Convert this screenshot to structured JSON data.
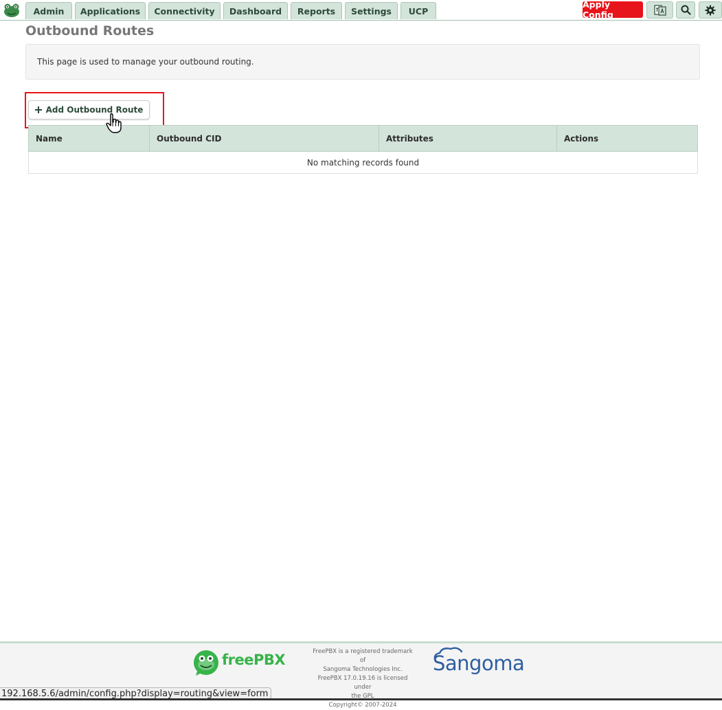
{
  "nav": {
    "tabs": [
      {
        "label": "Admin"
      },
      {
        "label": "Applications"
      },
      {
        "label": "Connectivity"
      },
      {
        "label": "Dashboard"
      },
      {
        "label": "Reports"
      },
      {
        "label": "Settings"
      },
      {
        "label": "UCP"
      }
    ],
    "apply_label": "Apply Config",
    "icons": [
      "language-icon",
      "search-icon",
      "gear-icon"
    ]
  },
  "page": {
    "title": "Outbound Routes",
    "info": "This page is used to manage your outbound routing.",
    "add_button": "Add Outbound Route"
  },
  "table": {
    "columns": [
      "Name",
      "Outbound CID",
      "Attributes",
      "Actions"
    ],
    "empty_message": "No matching records found"
  },
  "footer": {
    "freepbx_logo_text": "freePBX",
    "note_lines": [
      "FreePBX is a registered trademark of",
      "Sangoma Technologies Inc.",
      "FreePBX 17.0.19.16 is licensed under",
      "the GPL",
      "Copyright© 2007-2024"
    ],
    "sangoma_logo_text": "Sangoma"
  },
  "status_bar": {
    "url": "192.168.5.6/admin/config.php?display=routing&view=form"
  },
  "colors": {
    "accent_green": "#d3e4da",
    "apply_red": "#e8141b",
    "highlight_red": "#e8141b",
    "freepbx_green": "#37b34a",
    "sangoma_blue": "#2d5ea0"
  }
}
